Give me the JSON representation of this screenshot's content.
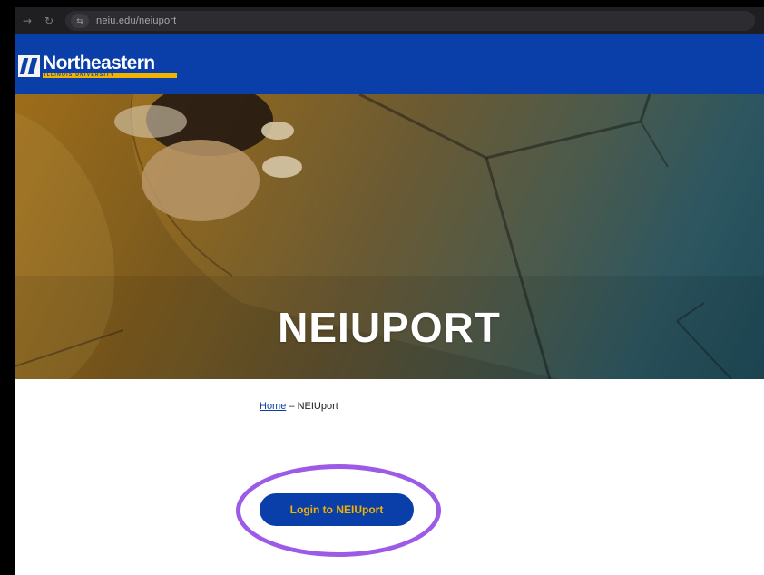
{
  "browser": {
    "url": "neiu.edu/neiuport"
  },
  "header": {
    "logo_name": "Northeastern",
    "logo_subtitle": "ILLINOIS UNIVERSITY",
    "brand_blue": "#0a3fa9",
    "brand_gold": "#f2b300"
  },
  "hero": {
    "title": "NEIUPORT"
  },
  "breadcrumb": {
    "home": "Home",
    "separator": " – ",
    "current": "NEIUport"
  },
  "main": {
    "login_label": "Login to NEIUport"
  },
  "annotation": {
    "ring_color": "#9d5ae6"
  }
}
